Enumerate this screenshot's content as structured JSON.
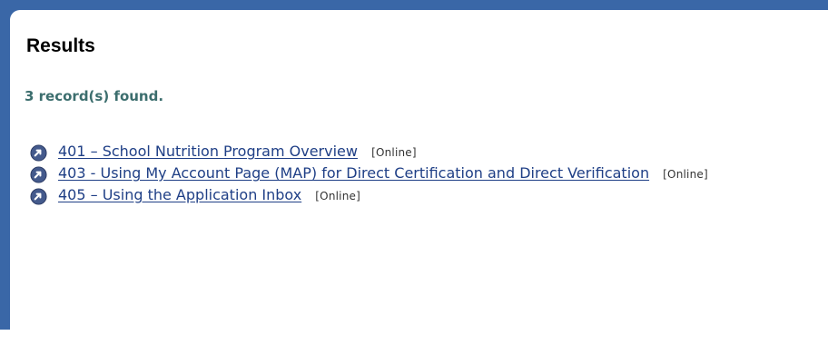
{
  "results": {
    "title": "Results",
    "count_text": "3 record(s) found."
  },
  "courses": [
    {
      "label": "401 – School Nutrition Program Overview",
      "tag": "[Online]"
    },
    {
      "label": "403 - Using My Account Page (MAP) for Direct Certification and Direct Verification",
      "tag": "[Online]"
    },
    {
      "label": "405 – Using the Application Inbox",
      "tag": "[Online]"
    }
  ],
  "colors": {
    "frame": "#3a67a7",
    "link": "#1f3f86",
    "count": "#3c6e6e",
    "bullet": "#445a8c"
  },
  "icons": {
    "bullet": "arrow-circle-icon"
  }
}
